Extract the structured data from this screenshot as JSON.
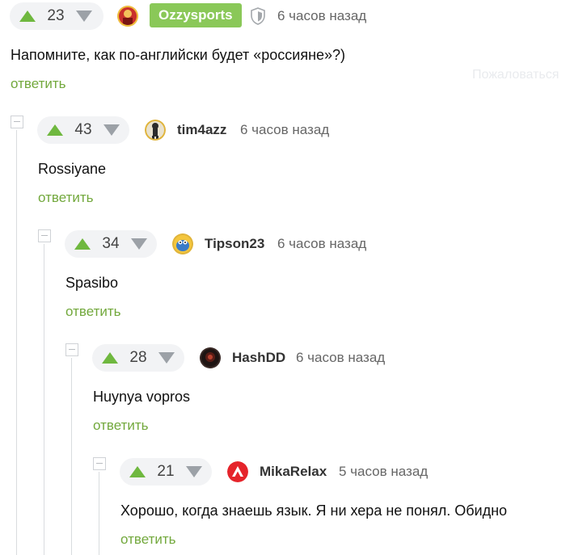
{
  "report_label": "Пожаловаться",
  "reply_label": "ответить",
  "colors": {
    "upvote": "#6fb83f",
    "downvote": "#9ca1a7",
    "reply": "#72a83c",
    "badge": "#8ac858"
  },
  "comments": [
    {
      "rating": "23",
      "username": "Ozzysports",
      "author_badge": true,
      "shield_icon": true,
      "time": "6 часов назад",
      "text": "Напомните, как по-английски будет «россияне»?)",
      "avatar_icon": "avatar-red-player-icon"
    },
    {
      "rating": "43",
      "username": "tim4azz",
      "time": "6 часов назад",
      "text": "Rossiyane",
      "avatar_icon": "avatar-figure-icon"
    },
    {
      "rating": "34",
      "username": "Tipson23",
      "time": "6 часов назад",
      "text": "Spasibo",
      "avatar_icon": "avatar-cartoon-icon"
    },
    {
      "rating": "28",
      "username": "HashDD",
      "time": "6 часов назад",
      "text": "Huynya vopros",
      "avatar_icon": "avatar-dark-icon"
    },
    {
      "rating": "21",
      "username": "MikaRelax",
      "time": "5 часов назад",
      "text": "Хорошо, когда знаешь язык. Я ни хера не понял. Обидно",
      "avatar_icon": "avatar-red-logo-icon"
    }
  ]
}
